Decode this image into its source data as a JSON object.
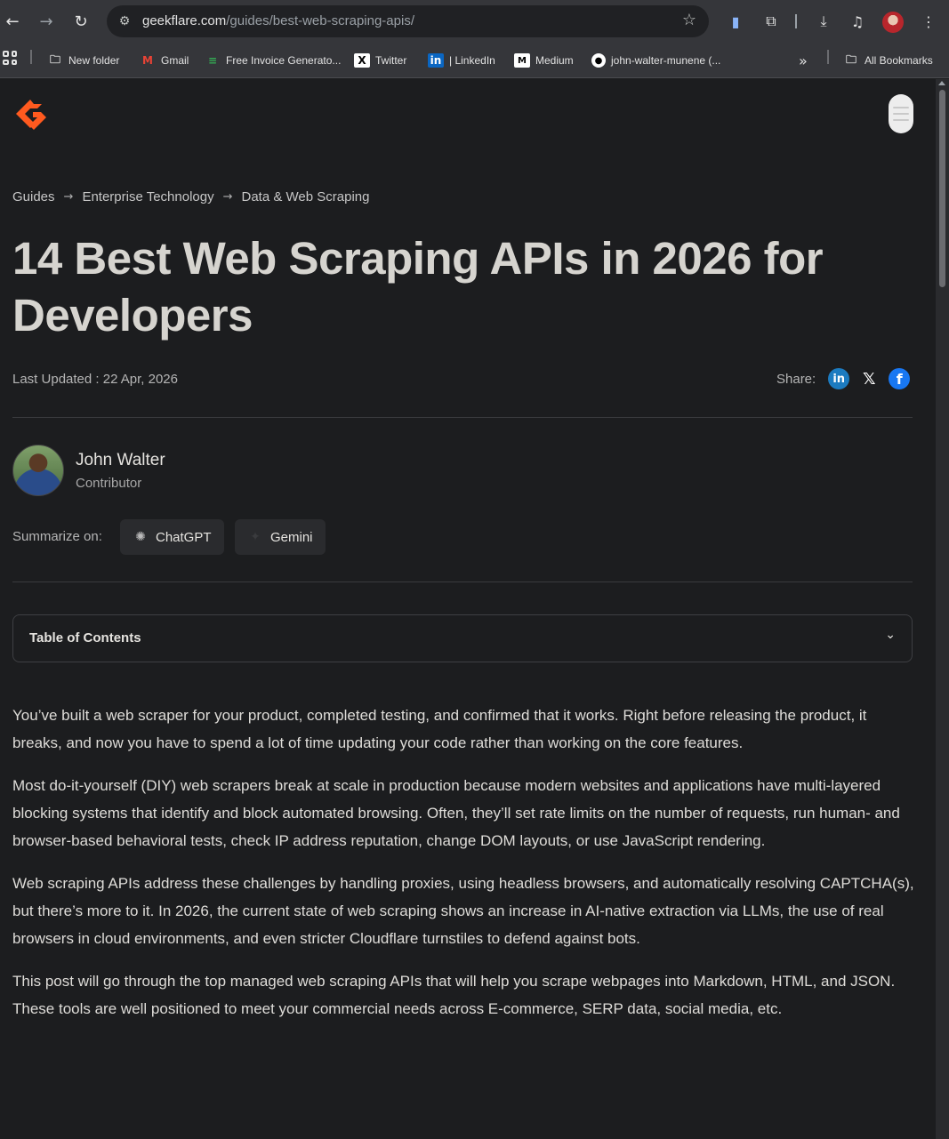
{
  "browser": {
    "url_domain": "geekflare.com",
    "url_path": "/guides/best-web-scraping-apis/",
    "bookmarks": [
      {
        "label": "New folder",
        "icon": "folder-icon"
      },
      {
        "label": "Gmail",
        "icon": "gmail-icon"
      },
      {
        "label": "Free Invoice Generato...",
        "icon": "invoice-icon"
      },
      {
        "label": "Twitter",
        "icon": "x-icon"
      },
      {
        "label": "| LinkedIn",
        "icon": "linkedin-icon"
      },
      {
        "label": "Medium",
        "icon": "medium-icon"
      },
      {
        "label": "john-walter-munene (...",
        "icon": "github-icon"
      }
    ],
    "all_bookmarks": "All Bookmarks"
  },
  "breadcrumb": [
    "Guides",
    "Enterprise Technology",
    "Data & Web Scraping"
  ],
  "article": {
    "title": "14 Best Web Scraping APIs in 2026 for Developers",
    "last_updated": "Last Updated : 22 Apr, 2026",
    "share_label": "Share:",
    "author_name": "John Walter",
    "author_role": "Contributor",
    "summarize_label": "Summarize on:",
    "summarize_chatgpt": "ChatGPT",
    "summarize_gemini": "Gemini",
    "toc_label": "Table of Contents",
    "paragraphs": [
      "You’ve built a web scraper for your product, completed testing, and confirmed that it works. Right before releasing the product, it breaks, and now you have to spend a lot of time updating your code rather than working on the core features.",
      "Most do-it-yourself (DIY) web scrapers break at scale in production because modern websites and applications have multi-layered blocking systems that identify and block automated browsing. Often, they’ll set rate limits on the number of requests, run human- and browser-based behavioral tests, check IP address reputation, change DOM layouts, or use JavaScript rendering.",
      "Web scraping APIs address these challenges by handling proxies, using headless browsers, and automatically resolving CAPTCHA(s), but there’s more to it. In 2026, the current state of web scraping shows an increase in AI-native extraction via LLMs, the use of real browsers in cloud environments, and even stricter Cloudflare turnstiles to defend against bots.",
      "This post will go through the top managed web scraping APIs that will help you scrape webpages into Markdown, HTML, and JSON. These tools are well positioned to meet your commercial needs across E-commerce, SERP data, social media, etc."
    ]
  },
  "colors": {
    "accent": "#ff5a1f",
    "background": "#1c1d1f"
  }
}
